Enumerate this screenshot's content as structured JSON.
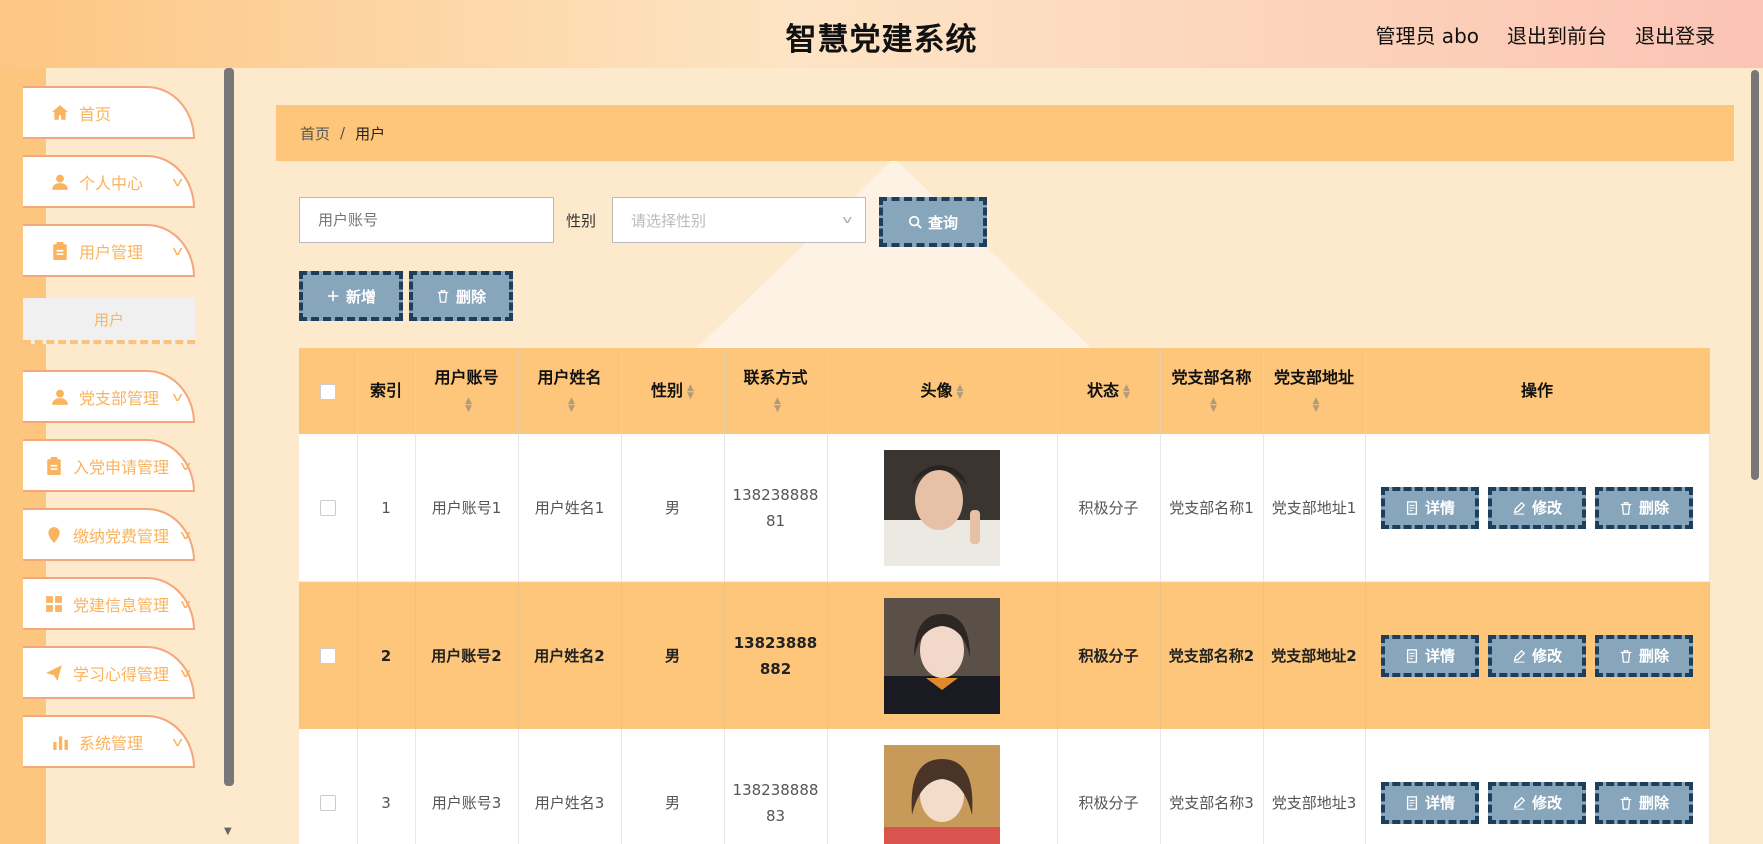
{
  "header": {
    "title": "智慧党建系统",
    "admin": "管理员 abo",
    "to_front": "退出到前台",
    "logout": "退出登录"
  },
  "sidebar": {
    "items": [
      {
        "label": "首页",
        "icon": "home-icon"
      },
      {
        "label": "个人中心",
        "icon": "person-icon"
      },
      {
        "label": "用户管理",
        "icon": "clipboard-icon"
      },
      {
        "label": "党支部管理",
        "icon": "person-icon"
      },
      {
        "label": "入党申请管理",
        "icon": "clipboard-icon"
      },
      {
        "label": "缴纳党费管理",
        "icon": "location-pin-icon"
      },
      {
        "label": "党建信息管理",
        "icon": "grid-icon"
      },
      {
        "label": "学习心得管理",
        "icon": "paper-plane-icon"
      },
      {
        "label": "系统管理",
        "icon": "bar-chart-icon"
      }
    ],
    "active_sub": "用户"
  },
  "breadcrumb": {
    "home": "首页",
    "sep": "/",
    "current": "用户"
  },
  "filters": {
    "account_placeholder": "用户账号",
    "gender_label": "性别",
    "gender_placeholder": "请选择性别",
    "search_label": "查询"
  },
  "actions": {
    "add_label": "新增",
    "delete_label": "删除"
  },
  "table": {
    "headers": {
      "index": "索引",
      "account": "用户账号",
      "name": "用户姓名",
      "gender": "性别",
      "phone": "联系方式",
      "avatar": "头像",
      "status": "状态",
      "branch_name": "党支部名称",
      "branch_addr": "党支部地址",
      "ops": "操作"
    },
    "rows": [
      {
        "index": "1",
        "account": "用户账号1",
        "name": "用户姓名1",
        "gender": "男",
        "phone": "13823888881",
        "status": "积极分子",
        "branch_name": "党支部名称1",
        "branch_addr": "党支部地址1"
      },
      {
        "index": "2",
        "account": "用户账号2",
        "name": "用户姓名2",
        "gender": "男",
        "phone": "13823888882",
        "status": "积极分子",
        "branch_name": "党支部名称2",
        "branch_addr": "党支部地址2"
      },
      {
        "index": "3",
        "account": "用户账号3",
        "name": "用户姓名3",
        "gender": "男",
        "phone": "13823888883",
        "status": "积极分子",
        "branch_name": "党支部名称3",
        "branch_addr": "党支部地址3"
      }
    ],
    "row_buttons": {
      "detail": "详情",
      "edit": "修改",
      "delete": "删除"
    }
  },
  "colors": {
    "accent": "#fdc67a",
    "button": "#87a5bb",
    "button_border": "#1d3f5c",
    "sidebar_text": "#fab35e"
  }
}
